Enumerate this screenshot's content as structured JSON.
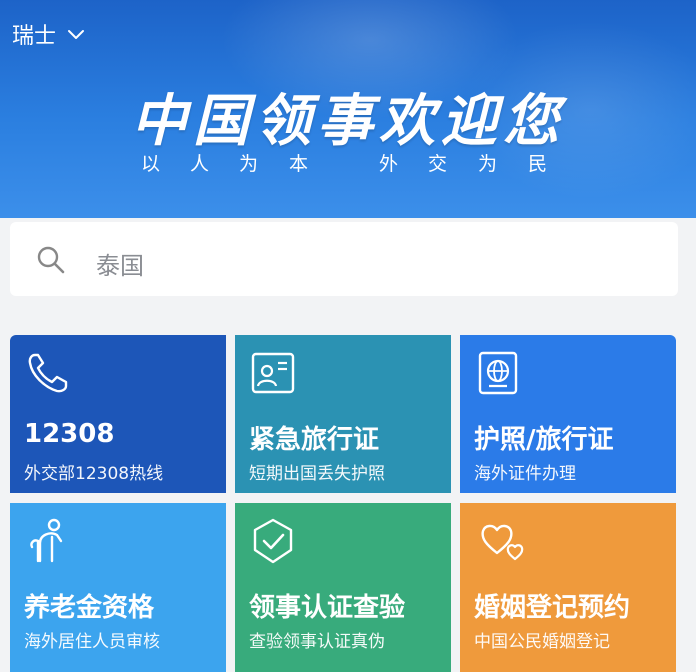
{
  "header": {
    "country": "瑞士",
    "title": "中国领事欢迎您",
    "slogan_left": [
      "以",
      "人",
      "为",
      "本"
    ],
    "slogan_right": [
      "外",
      "交",
      "为",
      "民"
    ]
  },
  "search": {
    "placeholder": "泰国"
  },
  "tiles": [
    {
      "title": "12308",
      "subtitle": "外交部12308热线",
      "icon": "phone-icon",
      "color": "#1d56b8"
    },
    {
      "title": "紧急旅行证",
      "subtitle": "短期出国丢失护照",
      "icon": "id-card-icon",
      "color": "#2b92b3"
    },
    {
      "title": "护照/旅行证",
      "subtitle": "海外证件办理",
      "icon": "passport-icon",
      "color": "#2b7be8"
    },
    {
      "title": "养老金资格",
      "subtitle": "海外居住人员审核",
      "icon": "elderly-person-icon",
      "color": "#3ca4ee"
    },
    {
      "title": "领事认证查验",
      "subtitle": "查验领事认证真伪",
      "icon": "shield-check-icon",
      "color": "#38ab7c"
    },
    {
      "title": "婚姻登记预约",
      "subtitle": "中国公民婚姻登记",
      "icon": "hearts-icon",
      "color": "#ef9a3c"
    }
  ]
}
